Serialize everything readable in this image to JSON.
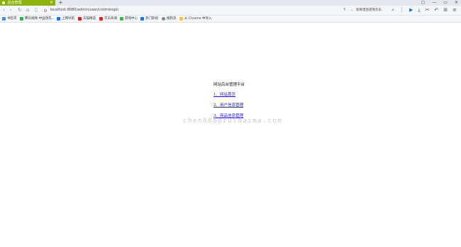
{
  "browser": {
    "tab": {
      "title": "后台管理"
    },
    "new_tab_symbol": "+",
    "window_controls": [
      "▢",
      "—",
      "▭",
      "✕"
    ],
    "address": {
      "url": "localhost:8080/admin/user/contrologin"
    },
    "search": {
      "placeholder": "新稀谱后遗保文乐"
    },
    "bookmarks": [
      {
        "label": "书签夹",
        "color": "#4a90d9"
      },
      {
        "label": "腾讯视频-中国领先...",
        "color": "#2bb24c"
      },
      {
        "label": "上网导航",
        "color": "#1a73e8"
      },
      {
        "label": "天猫精选",
        "color": "#e0161f"
      },
      {
        "label": "京东商城",
        "color": "#e1251b"
      },
      {
        "label": "游戏中心",
        "color": "#39b54a"
      },
      {
        "label": "热门影视",
        "color": "#1a73e8"
      },
      {
        "label": "搜狗流",
        "color": "#888888"
      },
      {
        "label": "从 Chrome 中导入",
        "color": "#f5c542"
      }
    ]
  },
  "page": {
    "title": "网站后台管理平台",
    "links": [
      {
        "label": "1、网站首页"
      },
      {
        "label": "2、用户信息管理"
      },
      {
        "label": "3、商品信息管理"
      }
    ],
    "watermark": "chen888@zuidaima.com"
  },
  "colors": {
    "tab_active": "#8db30a",
    "link": "#2222cc",
    "watermark": "#c9c9c9"
  }
}
